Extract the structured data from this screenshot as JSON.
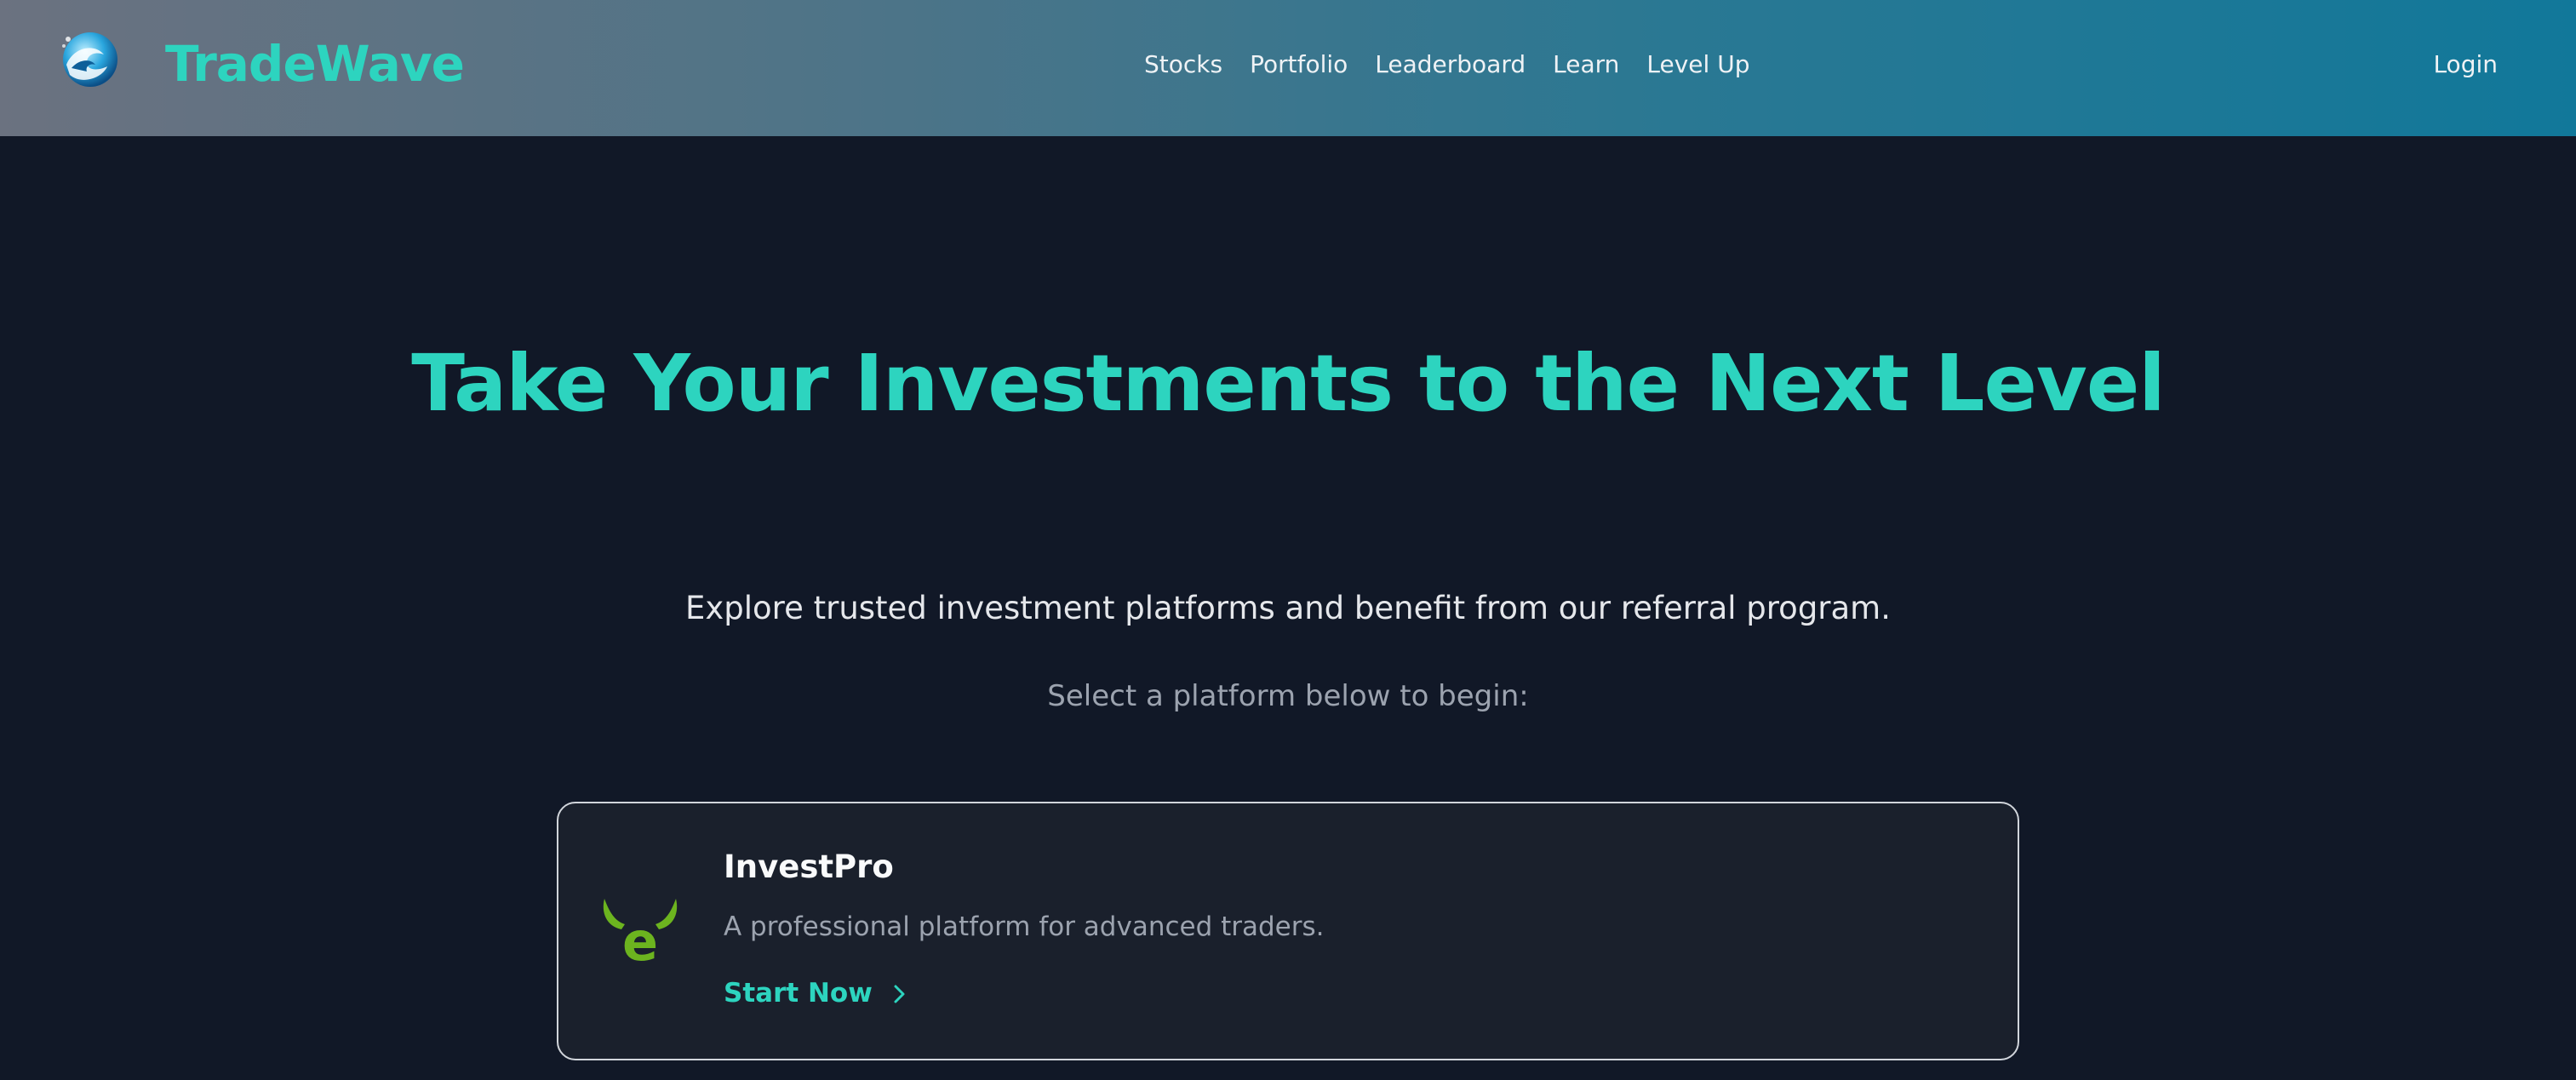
{
  "header": {
    "brand": "TradeWave",
    "logo_icon": "wave-logo-icon",
    "nav": [
      {
        "label": "Stocks"
      },
      {
        "label": "Portfolio"
      },
      {
        "label": "Leaderboard"
      },
      {
        "label": "Learn"
      },
      {
        "label": "Level Up"
      }
    ],
    "login_label": "Login"
  },
  "hero": {
    "title": "Take Your Investments to the Next Level",
    "subtitle": "Explore trusted investment platforms and benefit from our referral program.",
    "hint": "Select a platform below to begin:"
  },
  "platforms": [
    {
      "name": "InvestPro",
      "description": "A professional platform for advanced traders.",
      "cta": "Start Now",
      "logo_icon": "bull-e-logo-icon",
      "cta_icon": "chevron-right-icon"
    }
  ],
  "colors": {
    "accent": "#2dd4bf",
    "background": "#111827",
    "card_background": "#1a202c",
    "header_gradient_start": "#6b7280",
    "header_gradient_end": "#11789a",
    "platform_logo_green": "#6cb41f"
  }
}
